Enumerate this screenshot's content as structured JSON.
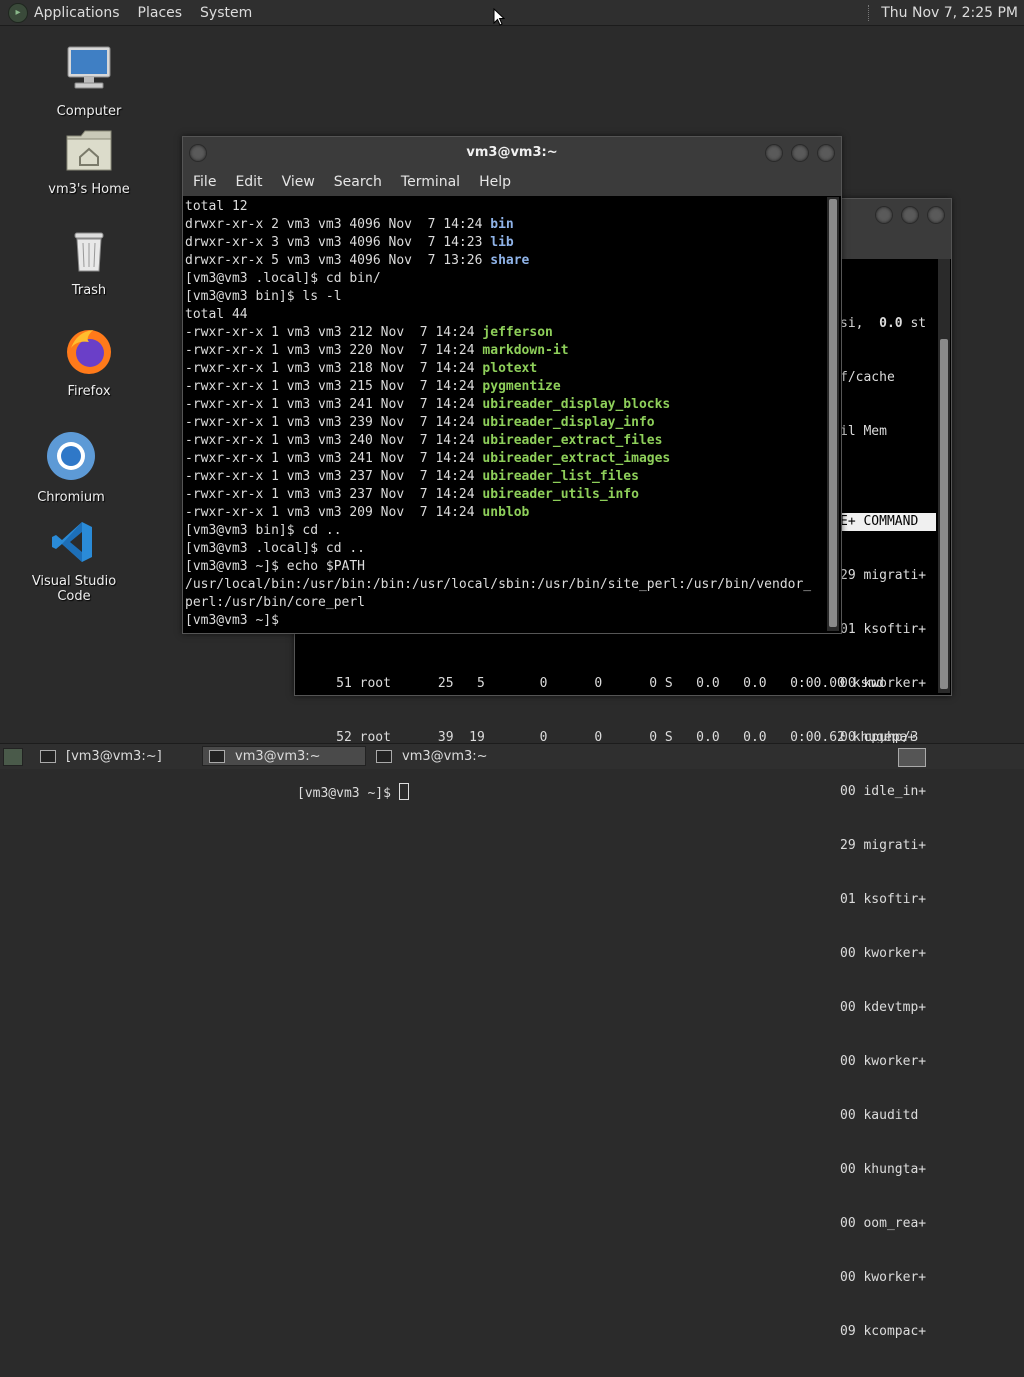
{
  "top_panel": {
    "menus": [
      "Applications",
      "Places",
      "System"
    ],
    "clock": "Thu Nov 7, 2:25 PM",
    "logo_icon": "distro-logo-icon"
  },
  "desktop": {
    "icons": [
      {
        "label": "Computer",
        "icon": "monitor-icon"
      },
      {
        "label": "vm3's Home",
        "icon": "home-folder-icon"
      },
      {
        "label": "Trash",
        "icon": "trash-icon"
      },
      {
        "label": "Firefox",
        "icon": "firefox-icon"
      },
      {
        "label": "Chromium",
        "icon": "chromium-icon"
      },
      {
        "label": "Visual Studio Code",
        "icon": "vscode-icon"
      }
    ]
  },
  "front_terminal": {
    "title": "vm3@vm3:~",
    "menu": [
      "File",
      "Edit",
      "View",
      "Search",
      "Terminal",
      "Help"
    ],
    "lines": [
      {
        "text": "total 12"
      },
      {
        "text": "drwxr-xr-x 2 vm3 vm3 4096 Nov  7 14:24 ",
        "name": "bin",
        "kind": "dir"
      },
      {
        "text": "drwxr-xr-x 3 vm3 vm3 4096 Nov  7 14:23 ",
        "name": "lib",
        "kind": "dir"
      },
      {
        "text": "drwxr-xr-x 5 vm3 vm3 4096 Nov  7 13:26 ",
        "name": "share",
        "kind": "dir"
      },
      {
        "text": "[vm3@vm3 .local]$ cd bin/"
      },
      {
        "text": "[vm3@vm3 bin]$ ls -l"
      },
      {
        "text": "total 44"
      },
      {
        "text": "-rwxr-xr-x 1 vm3 vm3 212 Nov  7 14:24 ",
        "name": "jefferson",
        "kind": "exe"
      },
      {
        "text": "-rwxr-xr-x 1 vm3 vm3 220 Nov  7 14:24 ",
        "name": "markdown-it",
        "kind": "exe"
      },
      {
        "text": "-rwxr-xr-x 1 vm3 vm3 218 Nov  7 14:24 ",
        "name": "plotext",
        "kind": "exe"
      },
      {
        "text": "-rwxr-xr-x 1 vm3 vm3 215 Nov  7 14:24 ",
        "name": "pygmentize",
        "kind": "exe"
      },
      {
        "text": "-rwxr-xr-x 1 vm3 vm3 241 Nov  7 14:24 ",
        "name": "ubireader_display_blocks",
        "kind": "exe"
      },
      {
        "text": "-rwxr-xr-x 1 vm3 vm3 239 Nov  7 14:24 ",
        "name": "ubireader_display_info",
        "kind": "exe"
      },
      {
        "text": "-rwxr-xr-x 1 vm3 vm3 240 Nov  7 14:24 ",
        "name": "ubireader_extract_files",
        "kind": "exe"
      },
      {
        "text": "-rwxr-xr-x 1 vm3 vm3 241 Nov  7 14:24 ",
        "name": "ubireader_extract_images",
        "kind": "exe"
      },
      {
        "text": "-rwxr-xr-x 1 vm3 vm3 237 Nov  7 14:24 ",
        "name": "ubireader_list_files",
        "kind": "exe"
      },
      {
        "text": "-rwxr-xr-x 1 vm3 vm3 237 Nov  7 14:24 ",
        "name": "ubireader_utils_info",
        "kind": "exe"
      },
      {
        "text": "-rwxr-xr-x 1 vm3 vm3 209 Nov  7 14:24 ",
        "name": "unblob",
        "kind": "exe"
      },
      {
        "text": "[vm3@vm3 bin]$ cd .."
      },
      {
        "text": "[vm3@vm3 .local]$ cd .."
      },
      {
        "text": "[vm3@vm3 ~]$ echo $PATH"
      },
      {
        "text": "/usr/local/bin:/usr/bin:/bin:/usr/local/sbin:/usr/bin/site_perl:/usr/bin/vendor_"
      },
      {
        "text": "perl:/usr/bin/core_perl"
      },
      {
        "text": "[vm3@vm3 ~]$ "
      }
    ]
  },
  "back_terminal": {
    "right_lines": [
      {
        "text": "si,  ",
        "bold": "0.0",
        "after": " st"
      },
      {
        "text": "f/cache"
      },
      {
        "text": "il Mem"
      },
      {
        "text": ""
      },
      {
        "text": "E+ COMMAND",
        "header": true
      },
      {
        "text": "29 migrati+"
      },
      {
        "text": "01 ksoftir+"
      },
      {
        "text": "00 kworker+"
      },
      {
        "text": "00 cpuhp/3"
      },
      {
        "text": "00 idle_in+"
      },
      {
        "text": "29 migrati+"
      },
      {
        "text": "01 ksoftir+"
      },
      {
        "text": "00 kworker+"
      },
      {
        "text": "00 kdevtmp+"
      },
      {
        "text": "00 kworker+"
      },
      {
        "text": "00 kauditd"
      },
      {
        "text": "00 khungta+"
      },
      {
        "text": "00 oom_rea+"
      },
      {
        "text": "00 kworker+"
      },
      {
        "text": "09 kcompac+"
      }
    ],
    "bottom_rows": [
      "     51 root      25   5       0      0      0 S   0.0   0.0   0:00.00 ksmd",
      "     52 root      39  19       0      0      0 S   0.0   0.0   0:00.62 khugepa+"
    ],
    "prompt": "[vm3@vm3 ~]$ "
  },
  "taskbar": {
    "tasks": [
      {
        "label": "[vm3@vm3:~]",
        "active": false
      },
      {
        "label": "vm3@vm3:~",
        "active": true
      },
      {
        "label": "vm3@vm3:~",
        "active": false
      }
    ]
  }
}
